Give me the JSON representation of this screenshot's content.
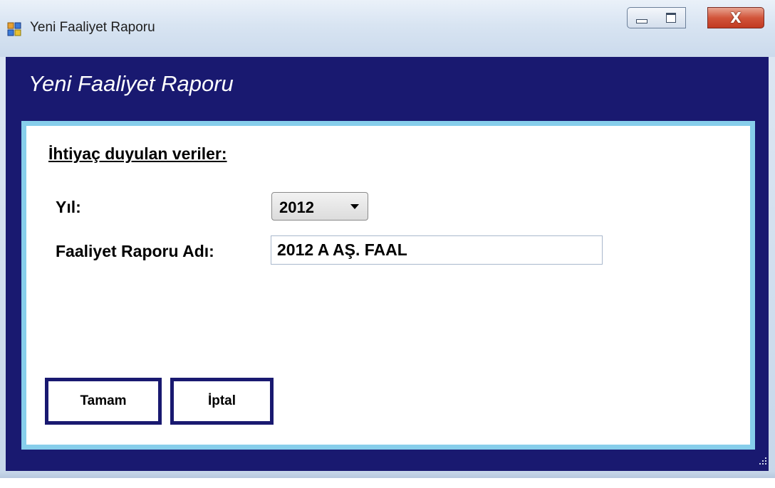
{
  "window": {
    "title": "Yeni Faaliyet Raporu",
    "close_glyph": "X",
    "colors": {
      "client_bg": "#191970",
      "panel_border": "#87ceeb",
      "button_border": "#191970"
    }
  },
  "form": {
    "header_title": "Yeni Faaliyet Raporu",
    "section_label": "İhtiyaç duyulan veriler:",
    "year_label": "Yıl:",
    "year_value": "2012",
    "report_name_label": "Faaliyet Raporu Adı:",
    "report_name_value": "2012 A AŞ. FAAL"
  },
  "buttons": {
    "ok_label": "Tamam",
    "cancel_label": "İptal"
  }
}
